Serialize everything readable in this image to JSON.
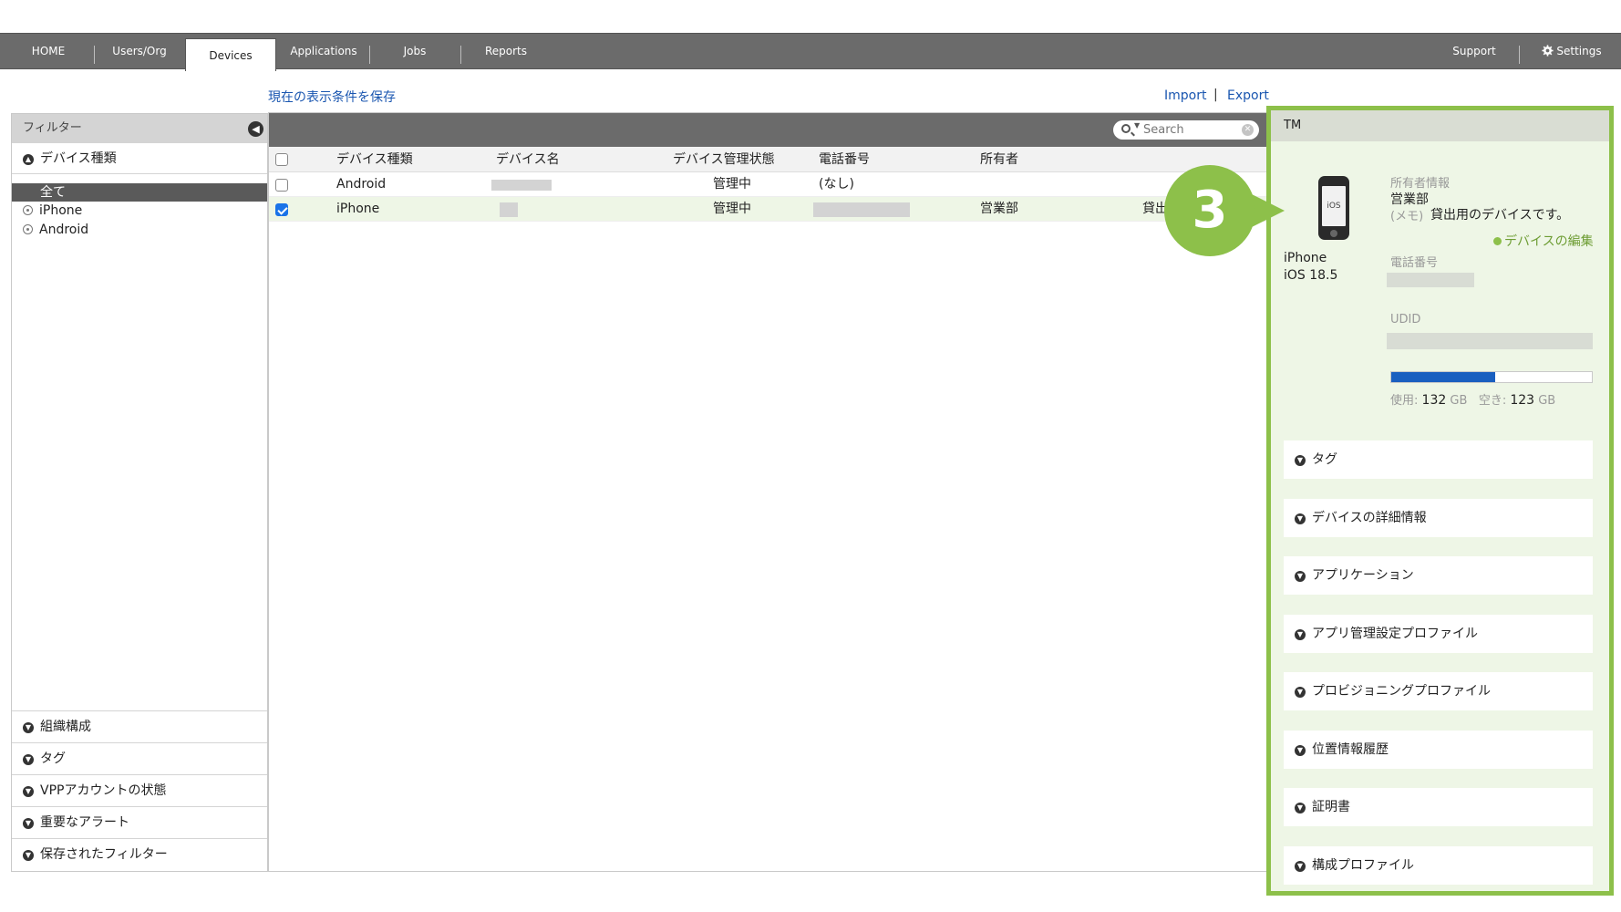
{
  "nav": {
    "items": [
      "HOME",
      "Users/Org",
      "Devices",
      "Applications",
      "Jobs",
      "Reports"
    ],
    "right": {
      "support": "Support",
      "settings": "Settings"
    }
  },
  "toolbar": {
    "save_view": "現在の表示条件を保存",
    "import": "Import",
    "separator": "|",
    "export": "Export"
  },
  "filter": {
    "title": "フィルター",
    "device_type": {
      "label": "デバイス種類",
      "options": [
        "全て",
        "iPhone",
        "Android"
      ],
      "selected": "全て"
    },
    "sections": [
      "組織構成",
      "タグ",
      "VPPアカウントの状態",
      "重要なアラート",
      "保存されたフィルター"
    ]
  },
  "search": {
    "placeholder": "Search"
  },
  "table": {
    "columns": [
      "デバイス種類",
      "デバイス名",
      "デバイス管理状態",
      "電話番号",
      "所有者"
    ],
    "rows": [
      {
        "type": "Android",
        "status": "管理中",
        "phone": "(なし)",
        "owner": "",
        "extra": "",
        "checked": false
      },
      {
        "type": "iPhone",
        "status": "管理中",
        "phone": "",
        "owner": "営業部",
        "extra": "貸出",
        "checked": true
      }
    ]
  },
  "detail": {
    "header": "TM",
    "model": "iPhone",
    "os": "iOS 18.5",
    "os_badge": "iOS",
    "owner_label": "所有者情報",
    "owner_value": "営業部",
    "memo_label": "(メモ)",
    "memo_value": "貸出用のデバイスです。",
    "edit_link": "デバイスの編集",
    "phone_label": "電話番号",
    "udid_label": "UDID",
    "storage": {
      "used_label": "使用:",
      "used_value": "132",
      "free_label": "空き:",
      "free_value": "123",
      "unit": "GB",
      "used_fraction": 0.52
    },
    "accordions": [
      "タグ",
      "デバイスの詳細情報",
      "アプリケーション",
      "アプリ管理設定プロファイル",
      "プロビジョニングプロファイル",
      "位置情報履歴",
      "証明書",
      "構成プロファイル"
    ]
  },
  "step_badge": "3",
  "colors": {
    "accent": "#8dc04a",
    "nav_bg": "#6b6b6b",
    "link": "#1a56b0",
    "storage_fill": "#1a5fc0"
  }
}
